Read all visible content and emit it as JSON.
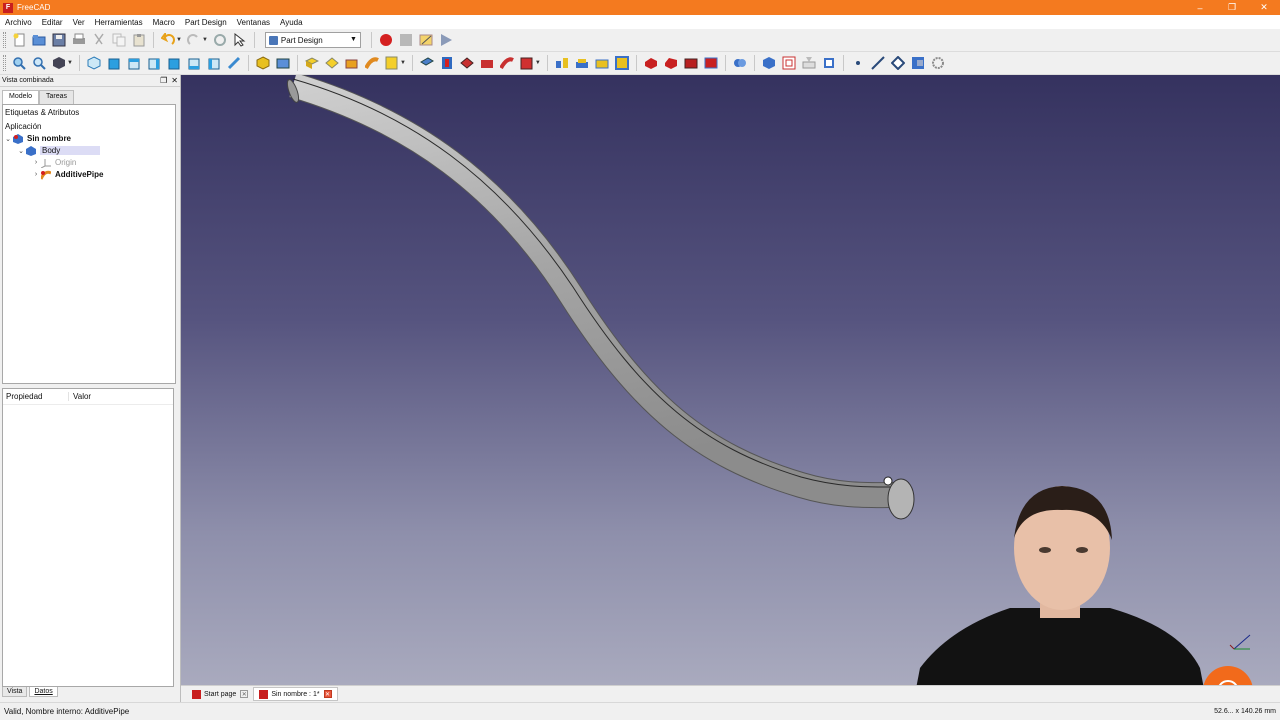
{
  "window": {
    "title": "FreeCAD",
    "app_icon_glyph": "F",
    "controls": [
      "–",
      "❐",
      "✕"
    ]
  },
  "menu": [
    "Archivo",
    "Editar",
    "Ver",
    "Herramientas",
    "Macro",
    "Part Design",
    "Ventanas",
    "Ayuda"
  ],
  "toolbar": {
    "workbench": "Part Design",
    "file_icons": [
      "new-file-icon",
      "open-file-icon",
      "save-icon",
      "print-icon",
      "cut-icon",
      "copy-icon",
      "paste-icon",
      "undo-icon",
      "redo-icon",
      "refresh-icon",
      "whats-this-icon"
    ],
    "macro_icons": [
      "record-macro-icon",
      "stop-macro-icon",
      "edit-macro-icon",
      "run-macro-icon"
    ]
  },
  "combo": {
    "title": "Vista combinada",
    "tabs": [
      "Modelo",
      "Tareas"
    ],
    "tree": {
      "labels_header": "Etiquetas & Atributos",
      "app_label": "Aplicación",
      "items": [
        {
          "label": "Sin nombre",
          "level": 0,
          "bold": true,
          "expanded": true,
          "icon": "document-icon"
        },
        {
          "label": "Body",
          "level": 1,
          "bold": false,
          "expanded": true,
          "icon": "body-icon",
          "selected": true
        },
        {
          "label": "Origin",
          "level": 2,
          "bold": false,
          "grey": true,
          "icon": "origin-icon"
        },
        {
          "label": "AdditivePipe",
          "level": 2,
          "bold": true,
          "icon": "additive-pipe-icon"
        }
      ]
    },
    "properties": {
      "col_property": "Propiedad",
      "col_value": "Valor"
    },
    "bottom_tabs": [
      "Vista",
      "Datos"
    ]
  },
  "doc_tabs": [
    {
      "label": "Start page",
      "active": false
    },
    {
      "label": "Sin nombre : 1*",
      "active": true
    }
  ],
  "statusbar": {
    "message": "Valid, Nombre interno: AdditivePipe",
    "dimensions": "52.6... x 140.26 mm"
  },
  "colors": {
    "title_bar": "#f47a1f",
    "view_top": "#35325f",
    "view_bottom": "#a9aabe",
    "pipe": "#a8a8a8",
    "logo": "#f26a1b"
  }
}
